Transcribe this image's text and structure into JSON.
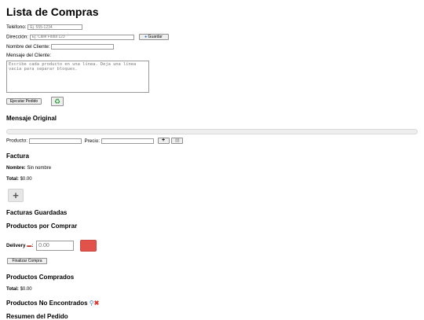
{
  "page": {
    "title": "Lista de Compras"
  },
  "contact": {
    "phone_label": "Teléfono:",
    "phone_placeholder": "Ej. 555-1234",
    "address_label": "Dirección:",
    "address_placeholder": "Ej. Calle Falsa 123",
    "save_label": "Guardar",
    "name_label": "Nombre del Cliente:",
    "name_value": "",
    "message_label": "Mensaje del Cliente:",
    "message_placeholder": "Escribe cada producto en una línea. Deja una línea vacía para separar bloques."
  },
  "actions": {
    "execute_label": "Ejecutar Pedido",
    "refresh_icon": "recycle-icon"
  },
  "original": {
    "heading": "Mensaje Original",
    "product_label": "Producto:",
    "product_value": "",
    "price_label": "Precio:",
    "price_value": "",
    "add_icon": "plus-icon",
    "delete_icon": "trash-icon"
  },
  "invoice": {
    "heading": "Factura",
    "name_label": "Nombre:",
    "name_value": "Sin nombre",
    "total_label": "Total:",
    "total_value": "$0.00"
  },
  "saved": {
    "heading": "Facturas Guardadas"
  },
  "to_buy": {
    "heading": "Productos por Comprar",
    "delivery_label": "Delivery",
    "delivery_icon": "motorcycle-icon",
    "delivery_placeholder": "0.00",
    "color_swatch": "#e0524a",
    "finish_label": "Finalizar Compra"
  },
  "bought": {
    "heading": "Productos Comprados",
    "total_label": "Total:",
    "total_value": "$0.00"
  },
  "not_found": {
    "heading": "Productos No Encontrados",
    "icons": [
      "magnifier-icon",
      "cross-icon"
    ]
  },
  "summary": {
    "heading": "Resumen del Pedido"
  }
}
